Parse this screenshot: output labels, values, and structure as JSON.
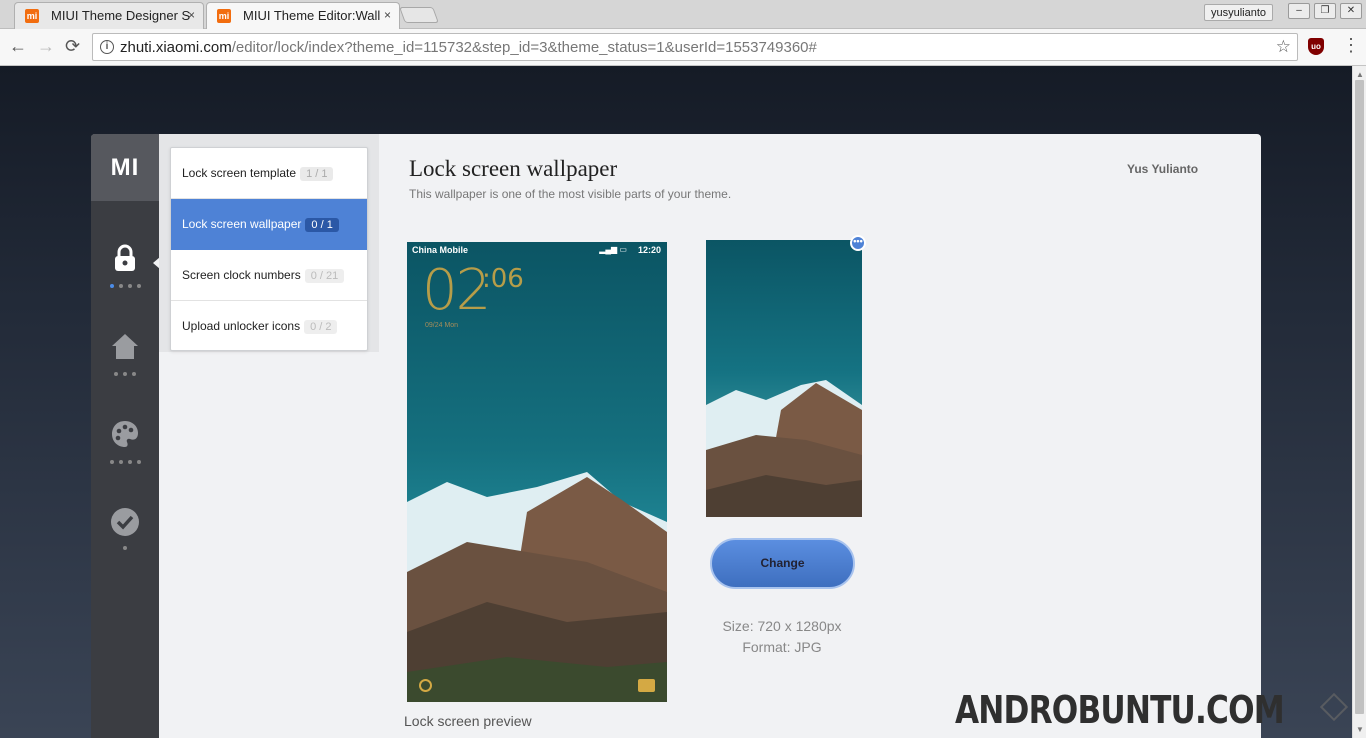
{
  "browser": {
    "tabs": [
      {
        "label": "MIUI Theme Designer S",
        "favicon": "mi"
      },
      {
        "label": "MIUI Theme Editor:Wall",
        "favicon": "mi"
      }
    ],
    "close_glyph": "×",
    "profile": "yusyulianto",
    "window_buttons": [
      "–",
      "❐",
      "✕"
    ],
    "nav": {
      "back": "←",
      "forward": "→",
      "reload": "⟳"
    },
    "url_host": "zhuti.xiaomi.com",
    "url_path": "/editor/lock/index?theme_id=115732&step_id=3&theme_status=1&userId=1553749360#",
    "bookmark_glyph": "☆",
    "extension_label": "uo",
    "menu_glyph": "⋮",
    "info_glyph": "i"
  },
  "app": {
    "logo": "MI",
    "accent_color": "#4e82d6",
    "rail_icons": [
      "lock-icon",
      "home-icon",
      "palette-icon",
      "check-icon"
    ],
    "submenu": [
      {
        "label": "Lock screen template",
        "count": "1 / 1"
      },
      {
        "label": "Lock screen wallpaper",
        "count": "0 / 1"
      },
      {
        "label": "Screen clock numbers",
        "count": "0 / 21"
      },
      {
        "label": "Upload unlocker icons",
        "count": "0 / 2"
      }
    ],
    "title": "Lock screen wallpaper",
    "subtitle": "This wallpaper is one of the most visible parts of your theme.",
    "author": "Yus Yulianto",
    "preview": {
      "carrier": "China Mobile",
      "time": "12:20",
      "clock_hours": "02",
      "clock_minutes": ":06",
      "date": "09/24   Mon"
    },
    "more_glyph": "•••",
    "change_button": "Change",
    "size": "Size: 720 x 1280px",
    "format": "Format: JPG",
    "preview_caption": "Lock screen preview"
  },
  "watermark": "ANDROBUNTU.COM"
}
